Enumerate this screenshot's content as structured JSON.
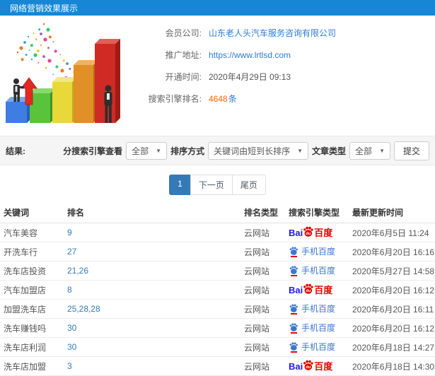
{
  "header": {
    "title": "网络营销效果展示"
  },
  "info": {
    "member_label": "会员公司:",
    "member_value": "山东老人头汽车服务咨询有限公司",
    "url_label": "推广地址:",
    "url_value": "https://www.lrtlsd.com",
    "open_label": "开通时间:",
    "open_value": "2020年4月29日 09:13",
    "rank_label": "搜索引擎排名:",
    "rank_count": "4648",
    "rank_unit": "条"
  },
  "filter": {
    "result_label": "结果:",
    "engine_label": "分搜索引擎查看",
    "engine_value": "全部",
    "sort_label": "排序方式",
    "sort_value": "关键词由短到长排序",
    "article_label": "文章类型",
    "article_value": "全部",
    "submit_label": "提交"
  },
  "pagination": {
    "items": [
      {
        "label": "1",
        "active": true
      },
      {
        "label": "下一页",
        "active": false
      },
      {
        "label": "尾页",
        "active": false
      }
    ]
  },
  "table": {
    "headers": [
      "关键词",
      "排名",
      "排名类型",
      "搜索引擎类型",
      "最新更新时间"
    ],
    "rows": [
      {
        "keyword": "汽车美容",
        "rank": "9",
        "rank_type": "云网站",
        "engine": "baidu",
        "time": "2020年6月5日 11:24"
      },
      {
        "keyword": "开洗车行",
        "rank": "27",
        "rank_type": "云网站",
        "engine": "baidu_mobile",
        "time": "2020年6月20日 16:16"
      },
      {
        "keyword": "洗车店投资",
        "rank": "21,26",
        "rank_type": "云网站",
        "engine": "baidu_mobile",
        "time": "2020年5月27日 14:58"
      },
      {
        "keyword": "汽车加盟店",
        "rank": "8",
        "rank_type": "云网站",
        "engine": "baidu",
        "time": "2020年6月20日 16:12"
      },
      {
        "keyword": "加盟洗车店",
        "rank": "25,28,28",
        "rank_type": "云网站",
        "engine": "baidu_mobile",
        "time": "2020年6月20日 16:11"
      },
      {
        "keyword": "洗车赚钱吗",
        "rank": "30",
        "rank_type": "云网站",
        "engine": "baidu_mobile",
        "time": "2020年6月20日 16:12"
      },
      {
        "keyword": "洗车店利润",
        "rank": "30",
        "rank_type": "云网站",
        "engine": "baidu_mobile",
        "time": "2020年6月18日 14:27"
      },
      {
        "keyword": "洗车店加盟",
        "rank": "3",
        "rank_type": "云网站",
        "engine": "baidu",
        "time": "2020年6月18日 14:30"
      }
    ],
    "engines": {
      "baidu": {
        "prefix": "Bai",
        "paw_text": "du",
        "suffix": "百度"
      },
      "baidu_mobile": {
        "label": "手机百度"
      }
    }
  },
  "colors": {
    "topbar_blue": "#1787d5",
    "link_blue": "#2e7bd0",
    "table_link_blue": "#337ab7",
    "rank_orange": "#ff6600",
    "baidu_blue": "#2319dc",
    "baidu_red": "#e10600",
    "mobile_baidu_blue": "#3c76d2"
  }
}
